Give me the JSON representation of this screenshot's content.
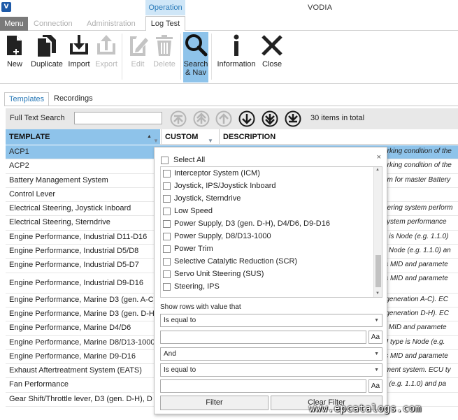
{
  "titlebar": {
    "logo": "V",
    "context_tab": "Operation",
    "title": "VODIA"
  },
  "ribbon_tabs": {
    "menu": "Menu",
    "connection": "Connection",
    "administration": "Administration",
    "log_test": "Log Test"
  },
  "ribbon": {
    "new": "New",
    "duplicate": "Duplicate",
    "import": "Import",
    "export": "Export",
    "edit": "Edit",
    "delete": "Delete",
    "search_nav_1": "Search",
    "search_nav_2": "& Nav",
    "information": "Information",
    "close": "Close"
  },
  "view_tabs": {
    "templates": "Templates",
    "recordings": "Recordings"
  },
  "search": {
    "label": "Full Text Search",
    "value": "",
    "items_total": "30 items in total"
  },
  "grid": {
    "headers": {
      "template": "TEMPLATE",
      "custom": "CUSTOM",
      "description": "DESCRIPTION"
    },
    "rows": [
      {
        "name": "ACP1",
        "desc": "orking condition of the"
      },
      {
        "name": "ACP2",
        "desc": "orking condition of the"
      },
      {
        "name": "Battery Management System",
        "desc": "em for master Battery"
      },
      {
        "name": "Control Lever",
        "desc": ""
      },
      {
        "name": "Electrical Steering, Joystick Inboard",
        "desc": "eering system perform"
      },
      {
        "name": "Electrical Steering, Sterndrive",
        "desc": "system performance"
      },
      {
        "name": "Engine Performance, Industrial D11-D16",
        "desc": "e is Node (e.g. 1.1.0)"
      },
      {
        "name": "Engine Performance, Industrial D5/D8",
        "desc": "s Node (e.g. 1.1.0) an"
      },
      {
        "name": "Engine Performance, Industrial D5-D7",
        "desc": "is MID and paramete"
      },
      {
        "name": "Engine Performance, Industrial D9-D16",
        "desc": "is MID and paramete"
      },
      {
        "name": "Engine Performance, Marine D3 (gen. A-C)",
        "desc": "(generation A-C). EC"
      },
      {
        "name": "Engine Performance, Marine D3 (gen. D-H)",
        "desc": "(generation D-H). EC"
      },
      {
        "name": "Engine Performance, Marine D4/D6",
        "desc": "s MID and paramete"
      },
      {
        "name": "Engine Performance, Marine D8/D13-1000",
        "desc": "U type is Node (e.g."
      },
      {
        "name": "Engine Performance, Marine D9-D16",
        "desc": "is MID and paramete"
      },
      {
        "name": "Exhaust Aftertreatment System (EATS)",
        "desc": "tment system. ECU ty"
      },
      {
        "name": "Fan Performance",
        "desc": "e (e.g. 1.1.0) and pa"
      },
      {
        "name": "Gear Shift/Throttle lever, D3 (gen. D-H), D",
        "desc": ""
      }
    ]
  },
  "filter_popup": {
    "close": "×",
    "select_all": "Select All",
    "options": [
      "Interceptor System (ICM)",
      "Joystick, IPS/Joystick Inboard",
      "Joystick, Sterndrive",
      "Low Speed",
      "Power Supply, D3 (gen. D-H), D4/D6, D9-D16",
      "Power Supply, D8/D13-1000",
      "Power Trim",
      "Selective Catalytic Reduction (SCR)",
      "Servo Unit Steering (SUS)",
      "Steering, IPS"
    ],
    "show_rows_label": "Show rows with value that",
    "operator1": "Is equal to",
    "value1": "",
    "match_case": "Aa",
    "logic": "And",
    "operator2": "Is equal to",
    "value2": "",
    "filter_button": "Filter",
    "clear_filter_button": "Clear Filter"
  },
  "watermark": "www.epcatalogs.com",
  "colors": {
    "accent": "#8ec3ea",
    "context": "#cfe6f7",
    "link": "#2a7ab8"
  }
}
